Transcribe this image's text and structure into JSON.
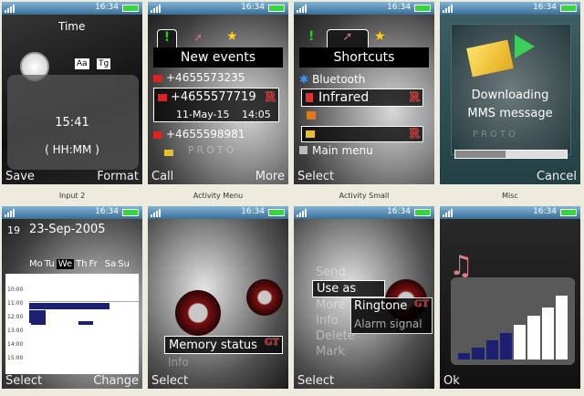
{
  "status": {
    "time": "16:34"
  },
  "captions": [
    "Input 2",
    "Activity Menu",
    "Activity Small",
    "Misc"
  ],
  "screens": {
    "time": {
      "title": "Time",
      "toggle_aa": "Aa",
      "toggle_tg": "Tg",
      "value": "15:41",
      "format": "( HH:MM )",
      "left": "Save",
      "right": "Format"
    },
    "events": {
      "header": "New events",
      "rows": [
        "+4655573235",
        "+4655577719",
        "11-May-15",
        "14:05",
        "+4655598981"
      ],
      "brand": "PROTO",
      "left": "Call",
      "right": "More"
    },
    "shortcuts": {
      "header": "Shortcuts",
      "items": [
        "Bluetooth",
        "Infrared",
        "",
        "Main menu"
      ],
      "left": "Select"
    },
    "mms": {
      "line1": "Downloading",
      "line2": "MMS message",
      "brand": "PROTO",
      "progress": 0.45,
      "right": "Cancel"
    },
    "calendar": {
      "day": "19",
      "date": "23-Sep-2005",
      "days": [
        "Mo",
        "Tu",
        "We",
        "Th",
        "Fr",
        "Sa",
        "Su"
      ],
      "hours": [
        "10:00",
        "11:00",
        "12:00",
        "13:00",
        "14:00",
        "15:00"
      ],
      "left": "Select",
      "right": "Change"
    },
    "activity": {
      "menu_item": "Memory status",
      "below": "Info",
      "left": "Select"
    },
    "context": {
      "items": [
        "Send",
        "Use as",
        "More",
        "Info",
        "Delete",
        "Mark"
      ],
      "sub_items": [
        "Ringtone",
        "Alarm signal"
      ],
      "left": "Select"
    },
    "volume": {
      "levels": [
        0.1,
        0.18,
        0.3,
        0.42,
        0.55,
        0.68,
        0.82,
        1.0
      ],
      "left": "Ok"
    }
  }
}
